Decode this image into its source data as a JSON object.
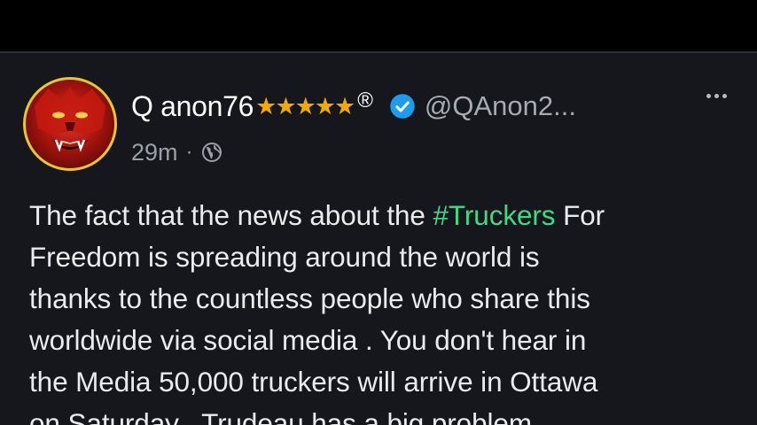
{
  "post": {
    "author": {
      "name": "Q anon76",
      "stars": "★★★★★",
      "reg_mark": "®",
      "handle": "@QAnon2...",
      "verified_icon": "verified-badge-icon",
      "avatar_icon": "red-lion-avatar"
    },
    "meta": {
      "time": "29m",
      "separator": "·",
      "visibility_icon": "globe-icon"
    },
    "more_icon": "more-options-icon",
    "body": {
      "line1_a": "The fact that the news about the ",
      "hashtag": "#Truckers",
      "line1_b": " For",
      "line2": "Freedom is spreading around the world is",
      "line3": "thanks to the countless people who share this",
      "line4": "worldwide via social media . You don't hear in",
      "line5": "the Media 50,000 truckers will arrive in Ottawa",
      "line6": "on Saturday . Trudeau has a big problem"
    }
  },
  "colors": {
    "background": "#15171c",
    "hashtag": "#3ddc84",
    "stars": "#f2a900",
    "verified": "#1d9bf0",
    "avatar_ring": "#e6c72c"
  }
}
